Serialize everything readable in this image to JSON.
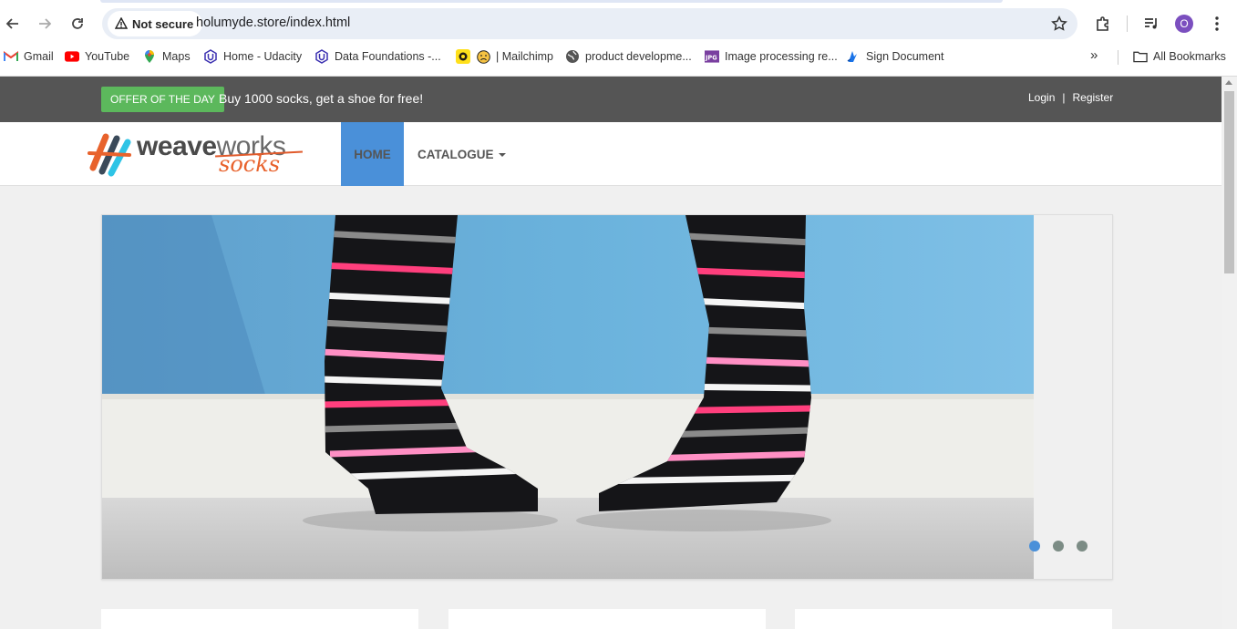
{
  "browser": {
    "security_label": "Not secure",
    "url": "holumyde.store/index.html",
    "avatar_letter": "O",
    "bookmarks": [
      {
        "label": "Gmail",
        "icon": "gmail-icon"
      },
      {
        "label": "YouTube",
        "icon": "youtube-icon"
      },
      {
        "label": "Maps",
        "icon": "maps-icon"
      },
      {
        "label": "Home - Udacity",
        "icon": "udacity-icon"
      },
      {
        "label": "Data Foundations -...",
        "icon": "udacity-icon"
      },
      {
        "label": "| Mailchimp",
        "icon": "mailchimp-icon"
      },
      {
        "label": "product developme...",
        "icon": "globe-icon"
      },
      {
        "label": "Image processing re...",
        "icon": "jpg-icon"
      },
      {
        "label": "Sign Document",
        "icon": "sign-icon"
      }
    ],
    "all_bookmarks_label": "All Bookmarks",
    "overflow_label": "»"
  },
  "site": {
    "offer_badge": "OFFER OF THE DAY",
    "offer_text": "Buy 1000 socks, get a shoe for free!",
    "login_label": "Login",
    "auth_separator": "|",
    "register_label": "Register",
    "logo_weave": "weave",
    "logo_works": "works",
    "logo_socks": "socks",
    "nav": {
      "home_label": "HOME",
      "catalogue_label": "CATALOGUE"
    },
    "carousel": {
      "active_slide": 1,
      "slide_count": 3
    }
  },
  "colors": {
    "topbar": "#555555",
    "offer_green": "#5cb85c",
    "accent_blue": "#4a90d9",
    "logo_orange": "#e8622c"
  }
}
